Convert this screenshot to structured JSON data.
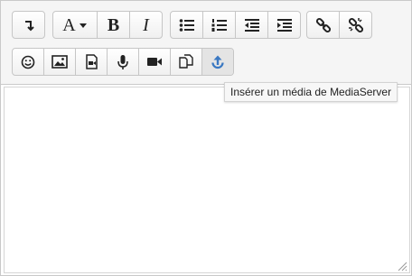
{
  "toolbar": {
    "font_letter": "A",
    "bold_label": "B",
    "italic_label": "I"
  },
  "tooltip": {
    "text": "Insérer un média de MediaServer"
  },
  "icons": [
    "arrow-down-left-icon",
    "font-color-icon",
    "bold-icon",
    "italic-icon",
    "bullet-list-icon",
    "numbered-list-icon",
    "outdent-icon",
    "indent-icon",
    "link-icon",
    "unlink-icon",
    "emoticon-icon",
    "image-icon",
    "media-file-icon",
    "microphone-icon",
    "video-camera-icon",
    "copy-files-icon",
    "mediaserver-upload-icon",
    "resize-handle-icon"
  ],
  "colors": {
    "accent": "#3a78c2"
  }
}
